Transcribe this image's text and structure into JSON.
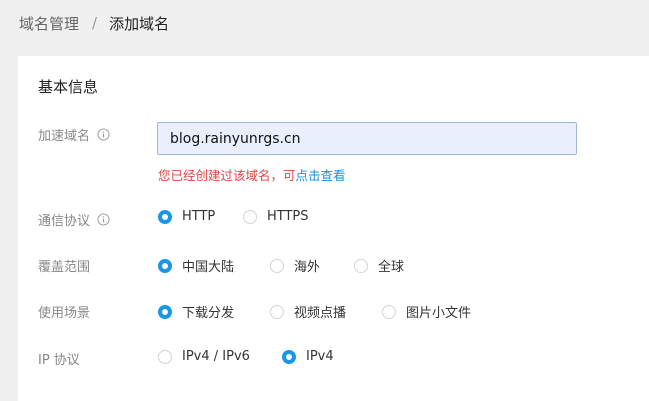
{
  "breadcrumb": {
    "parent": "域名管理",
    "separator": "/",
    "current": "添加域名"
  },
  "section_title": "基本信息",
  "domain": {
    "label": "加速域名",
    "value": "blog.rainyunrgs.cn",
    "error_text": "您已经创建过该域名，可",
    "error_link": "点击查看"
  },
  "protocol": {
    "label": "通信协议",
    "options": [
      "HTTP",
      "HTTPS"
    ],
    "selected": "HTTP"
  },
  "coverage": {
    "label": "覆盖范围",
    "options": [
      "中国大陆",
      "海外",
      "全球"
    ],
    "selected": "中国大陆"
  },
  "scenario": {
    "label": "使用场景",
    "options": [
      "下载分发",
      "视频点播",
      "图片小文件"
    ],
    "selected": "下载分发"
  },
  "ip_protocol": {
    "label": "IP 协议",
    "options": [
      "IPv4 / IPv6",
      "IPv4"
    ],
    "selected": "IPv4"
  },
  "colors": {
    "accent": "#1a96e8",
    "error": "#e04343",
    "link": "#1a8fd8"
  }
}
